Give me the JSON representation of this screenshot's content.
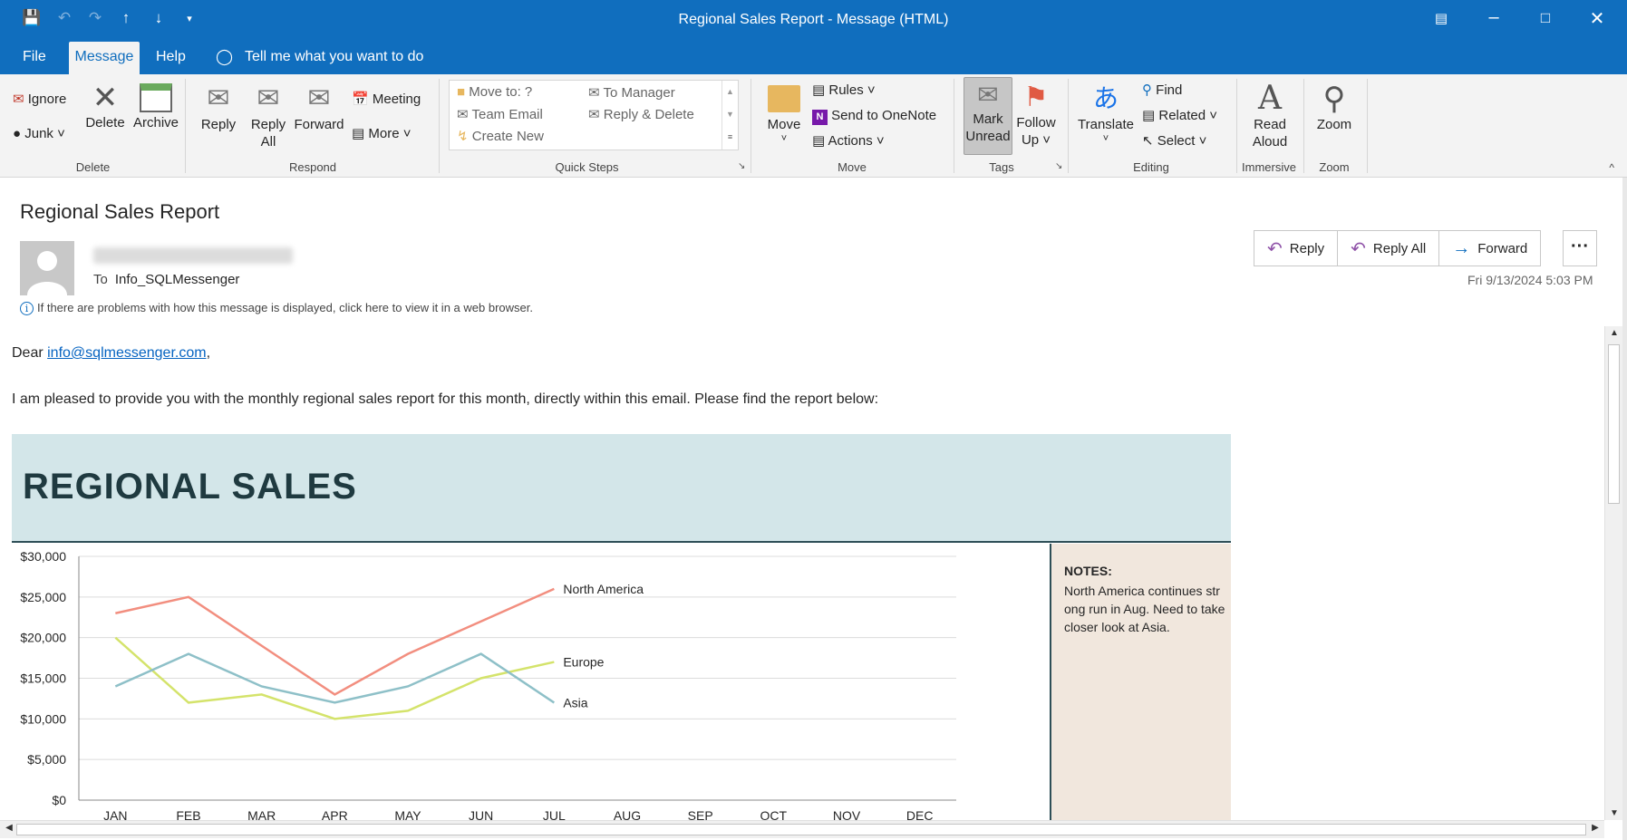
{
  "window": {
    "title": "Regional Sales Report  -  Message (HTML)"
  },
  "menu": {
    "tabs": [
      "File",
      "Message",
      "Help"
    ],
    "tell_me": "Tell me what you want to do"
  },
  "ribbon": {
    "delete_group": {
      "label": "Delete",
      "ignore": "Ignore",
      "junk": "Junk",
      "delete": "Delete",
      "archive": "Archive"
    },
    "respond_group": {
      "label": "Respond",
      "reply": "Reply",
      "reply_all_1": "Reply",
      "reply_all_2": "All",
      "forward": "Forward",
      "meeting": "Meeting",
      "more": "More"
    },
    "quick_steps": {
      "label": "Quick Steps",
      "items": [
        "Move to: ?",
        "To Manager",
        "Team Email",
        "Reply & Delete",
        "Create New"
      ]
    },
    "move_group": {
      "label": "Move",
      "move": "Move",
      "rules": "Rules",
      "onenote": "Send to OneNote",
      "actions": "Actions"
    },
    "tags_group": {
      "label": "Tags",
      "mark_unread_1": "Mark",
      "mark_unread_2": "Unread",
      "follow_up_1": "Follow",
      "follow_up_2": "Up"
    },
    "editing_group": {
      "label": "Editing",
      "translate": "Translate",
      "find": "Find",
      "related": "Related",
      "select": "Select"
    },
    "immersive_group": {
      "label": "Immersive",
      "read_aloud_1": "Read",
      "read_aloud_2": "Aloud"
    },
    "zoom_group": {
      "label": "Zoom",
      "zoom": "Zoom"
    }
  },
  "message": {
    "subject": "Regional Sales Report",
    "to_label": "To",
    "to_value": "Info_SQLMessenger",
    "info_bar": "If there are problems with how this message is displayed, click here to view it in a web browser.",
    "date": "Fri 9/13/2024 5:03 PM",
    "actions": {
      "reply": "Reply",
      "reply_all": "Reply All",
      "forward": "Forward",
      "more": "···"
    },
    "greeting_prefix": "Dear ",
    "greeting_link": "info@sqlmessenger.com",
    "greeting_suffix": ",",
    "intro": "I am pleased to provide you with the monthly regional sales report for this month, directly within this email. Please find the report below:"
  },
  "report": {
    "title": "REGIONAL SALES",
    "notes_title": "NOTES:",
    "notes_text": "North America continues str\nong run in Aug. Need to take\ncloser look at Asia."
  },
  "chart_data": {
    "type": "line",
    "categories": [
      "JAN",
      "FEB",
      "MAR",
      "APR",
      "MAY",
      "JUN",
      "JUL",
      "AUG",
      "SEP",
      "OCT",
      "NOV",
      "DEC"
    ],
    "y_ticks": [
      "$0",
      "$5,000",
      "$10,000",
      "$15,000",
      "$20,000",
      "$25,000",
      "$30,000"
    ],
    "ylim": [
      0,
      30000
    ],
    "grid": true,
    "series": [
      {
        "name": "North America",
        "color": "#f28e7f",
        "values": [
          23000,
          25000,
          19000,
          13000,
          18000,
          22000,
          26000
        ]
      },
      {
        "name": "Europe",
        "color": "#d4e36b",
        "values": [
          20000,
          12000,
          13000,
          10000,
          11000,
          15000,
          17000
        ]
      },
      {
        "name": "Asia",
        "color": "#8ec0c8",
        "values": [
          14000,
          18000,
          14000,
          12000,
          14000,
          18000,
          12000
        ]
      }
    ]
  }
}
